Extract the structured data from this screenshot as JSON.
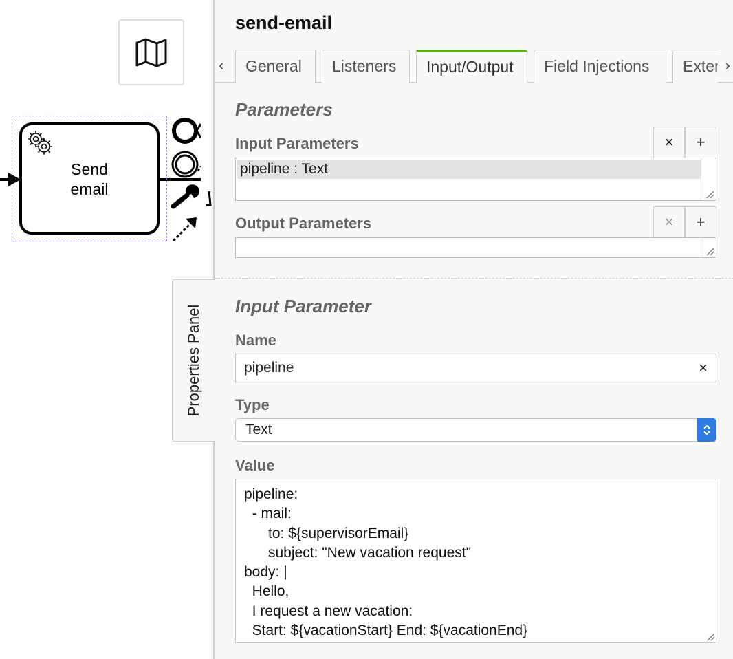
{
  "canvas": {
    "task": {
      "label": "Send\nemail"
    },
    "icons": {
      "minimap": "map-icon",
      "gear": "gear-icon",
      "end_event": "end-event-icon",
      "intermediate_event": "intermediate-event-icon",
      "wrench": "wrench-icon",
      "connect": "connect-arrow-icon"
    }
  },
  "panel_toggle": {
    "label": "Properties Panel"
  },
  "panel": {
    "title": "send-email",
    "tabs": [
      {
        "label": "General"
      },
      {
        "label": "Listeners"
      },
      {
        "label": "Input/Output",
        "active": true
      },
      {
        "label": "Field Injections"
      },
      {
        "label": "Extensions"
      }
    ],
    "parameters": {
      "heading": "Parameters",
      "input": {
        "label": "Input Parameters",
        "items": [
          "pipeline : Text"
        ],
        "remove_label": "×",
        "add_label": "+"
      },
      "output": {
        "label": "Output Parameters",
        "items": [],
        "remove_label": "×",
        "add_label": "+"
      }
    },
    "input_parameter": {
      "heading": "Input Parameter",
      "name_label": "Name",
      "name_value": "pipeline",
      "clear_label": "×",
      "type_label": "Type",
      "type_value": "Text",
      "value_label": "Value",
      "value_text": "pipeline:\n  - mail:\n      to: ${supervisorEmail}\n      subject: \"New vacation request\"\nbody: |\n  Hello,\n  I request a new vacation:\n  Start: ${vacationStart} End: ${vacationEnd}"
    }
  },
  "colors": {
    "active_tab_accent": "#52b415",
    "select_accent": "#2f7de1",
    "selection_outline": "#8c8ce6"
  }
}
